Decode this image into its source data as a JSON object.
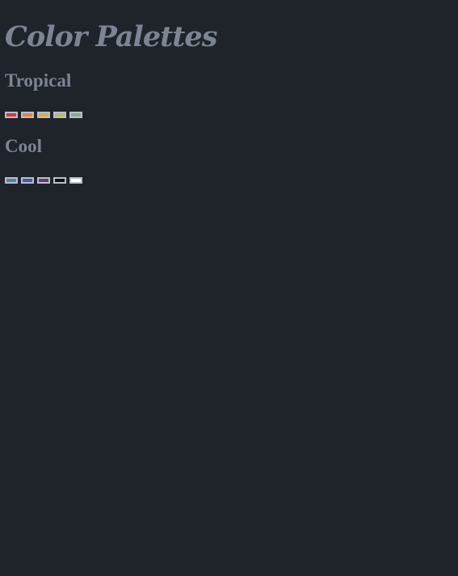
{
  "app": {
    "title": "Color Palettes"
  },
  "palettes": [
    {
      "name": "Tropical",
      "swatches": [
        {
          "color": "#d53b37"
        },
        {
          "color": "#e9813f"
        },
        {
          "color": "#e4a83d"
        },
        {
          "color": "#b4c05c"
        },
        {
          "color": "#7fb08c"
        }
      ]
    },
    {
      "name": "Cool",
      "swatches": [
        {
          "color": "#4e7fbd"
        },
        {
          "color": "#4a57a6"
        },
        {
          "color": "#7a2f86"
        },
        {
          "color": "#101010"
        },
        {
          "color": "#ffffff"
        }
      ]
    }
  ]
}
